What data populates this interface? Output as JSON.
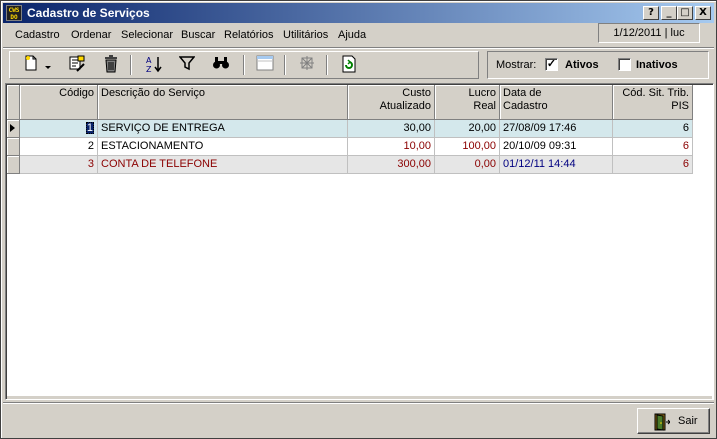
{
  "window": {
    "title": "Cadastro de Serviços",
    "app_icon_text": "CWS\nDO"
  },
  "title_buttons": [
    "?",
    "_",
    "□",
    "X"
  ],
  "menu": [
    {
      "label": "Cadastro",
      "underline": "C"
    },
    {
      "label": "Ordenar",
      "underline": "O"
    },
    {
      "label": "Selecionar",
      "underline": "S"
    },
    {
      "label": "Buscar",
      "underline": "B"
    },
    {
      "label": "Relatórios",
      "underline": "R"
    },
    {
      "label": "Utilitários",
      "underline": "U"
    },
    {
      "label": "Ajuda",
      "underline": "j"
    }
  ],
  "status": {
    "date_user": "1/12/2011 | luc"
  },
  "toolbar": {
    "icons": [
      "new-icon",
      "dropdown-arrow-icon",
      "edit-icon",
      "delete-icon",
      "sort-az-icon",
      "filter-icon",
      "find-icon",
      "view-icon",
      "settings-icon",
      "refresh-icon"
    ]
  },
  "filter": {
    "label": "Mostrar:",
    "ativos": {
      "label": "Ativos",
      "checked": true
    },
    "inativos": {
      "label": "Inativos",
      "checked": false
    }
  },
  "grid": {
    "columns": [
      "Código",
      "Descrição do Serviço",
      "Custo\nAtualizado",
      "Lucro\nReal",
      "Data de\nCadastro",
      "Cód. Sit. Trib.\nPIS"
    ],
    "rows": [
      {
        "codigo": "1",
        "descricao": "SERVIÇO DE ENTREGA",
        "custo": "30,00",
        "lucro": "20,00",
        "data": "27/08/09 17:46",
        "pis": "6"
      },
      {
        "codigo": "2",
        "descricao": "ESTACIONAMENTO",
        "custo": "10,00",
        "lucro": "100,00",
        "data": "20/10/09 09:31",
        "pis": "6"
      },
      {
        "codigo": "3",
        "descricao": "CONTA DE TELEFONE",
        "custo": "300,00",
        "lucro": "0,00",
        "data": "01/12/11 14:44",
        "pis": "6"
      }
    ]
  },
  "buttons": {
    "sair": "Sair"
  },
  "colors": {
    "title_start": "#0a246a",
    "title_end": "#a6caf0",
    "selected_row": "#d4e8ec",
    "value_red": "#8b0000",
    "date_blue": "#000080"
  }
}
